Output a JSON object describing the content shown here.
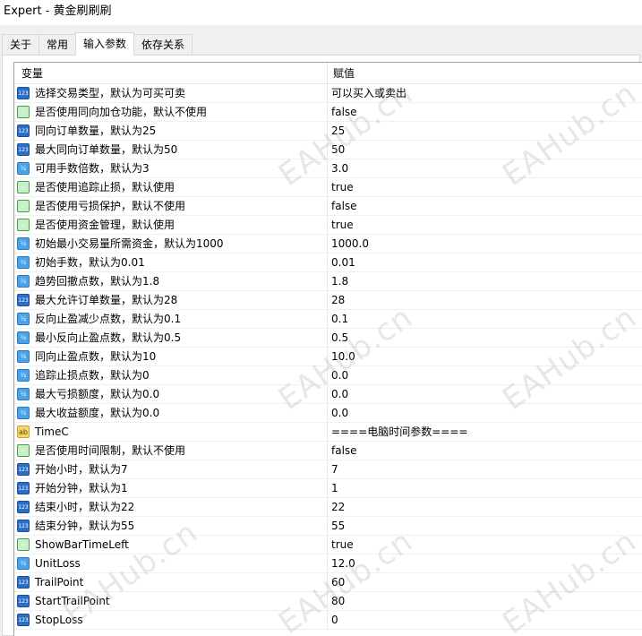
{
  "window": {
    "title": "Expert - 黄金刷刷刷"
  },
  "tabs": [
    {
      "label": "关于"
    },
    {
      "label": "常用"
    },
    {
      "label": "输入参数"
    },
    {
      "label": "依存关系"
    }
  ],
  "grid": {
    "headers": {
      "variable": "变量",
      "value": "赋值"
    },
    "rows": [
      {
        "icon": "int",
        "name": "选择交易类型，默认为可买可卖",
        "value": "可以买入或卖出"
      },
      {
        "icon": "bool",
        "name": "是否使用同向加仓功能，默认不使用",
        "value": "false"
      },
      {
        "icon": "int",
        "name": "同向订单数量，默认为25",
        "value": "25"
      },
      {
        "icon": "int",
        "name": "最大同向订单数量，默认为50",
        "value": "50"
      },
      {
        "icon": "double",
        "name": "可用手数倍数，默认为3",
        "value": "3.0"
      },
      {
        "icon": "bool",
        "name": "是否使用追踪止损，默认使用",
        "value": "true"
      },
      {
        "icon": "bool",
        "name": "是否使用亏损保护，默认不使用",
        "value": "false"
      },
      {
        "icon": "bool",
        "name": "是否使用资金管理，默认使用",
        "value": "true"
      },
      {
        "icon": "double",
        "name": "初始最小交易量所需资金，默认为1000",
        "value": "1000.0"
      },
      {
        "icon": "double",
        "name": "初始手数，默认为0.01",
        "value": "0.01"
      },
      {
        "icon": "double",
        "name": "趋势回撤点数，默认为1.8",
        "value": "1.8"
      },
      {
        "icon": "int",
        "name": "最大允许订单数量，默认为28",
        "value": "28"
      },
      {
        "icon": "double",
        "name": "反向止盈减少点数，默认为0.1",
        "value": "0.1"
      },
      {
        "icon": "double",
        "name": "最小反向止盈点数，默认为0.5",
        "value": "0.5"
      },
      {
        "icon": "double",
        "name": "同向止盈点数，默认为10",
        "value": "10.0"
      },
      {
        "icon": "double",
        "name": "追踪止损点数，默认为0",
        "value": "0.0"
      },
      {
        "icon": "double",
        "name": "最大亏损额度，默认为0.0",
        "value": "0.0"
      },
      {
        "icon": "double",
        "name": "最大收益额度，默认为0.0",
        "value": "0.0"
      },
      {
        "icon": "string",
        "name": "TimeC",
        "value": "====电脑时间参数===="
      },
      {
        "icon": "bool",
        "name": "是否使用时间限制，默认不使用",
        "value": "false"
      },
      {
        "icon": "int",
        "name": "开始小时，默认为7",
        "value": "7"
      },
      {
        "icon": "int",
        "name": "开始分钟，默认为1",
        "value": "1"
      },
      {
        "icon": "int",
        "name": "结束小时，默认为22",
        "value": "22"
      },
      {
        "icon": "int",
        "name": "结束分钟，默认为55",
        "value": "55"
      },
      {
        "icon": "bool",
        "name": "ShowBarTimeLeft",
        "value": "true"
      },
      {
        "icon": "double",
        "name": "UnitLoss",
        "value": "12.0"
      },
      {
        "icon": "int",
        "name": "TrailPoint",
        "value": "60"
      },
      {
        "icon": "int",
        "name": "StartTrailPoint",
        "value": "80"
      },
      {
        "icon": "int",
        "name": "StopLoss",
        "value": "0"
      }
    ]
  },
  "icon_glyphs": {
    "int": "123",
    "bool": "✓",
    "double": "½",
    "string": "ab"
  },
  "watermark": "EAHub.cn"
}
